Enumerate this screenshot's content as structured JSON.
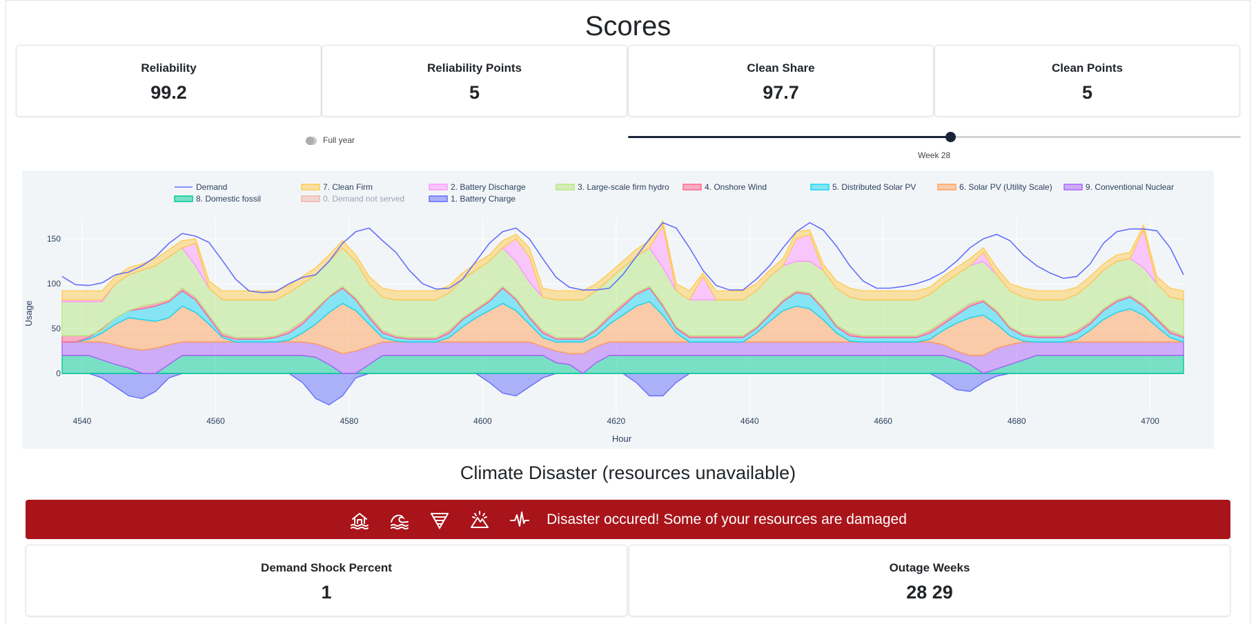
{
  "header": {
    "title": "Scores"
  },
  "scores": [
    {
      "label": "Reliability",
      "value": "99.2"
    },
    {
      "label": "Reliability Points",
      "value": "5"
    },
    {
      "label": "Clean Share",
      "value": "97.7"
    },
    {
      "label": "Clean Points",
      "value": "5"
    }
  ],
  "controls": {
    "full_year_label": "Full year",
    "full_year_on": false,
    "week_label": "Week 28",
    "week_value": 28
  },
  "chart_data": {
    "type": "area",
    "xlabel": "Hour",
    "ylabel": "Usage",
    "xlim": [
      4537,
      4705
    ],
    "ylim": [
      -45,
      180
    ],
    "x_ticks": [
      4540,
      4560,
      4580,
      4600,
      4620,
      4640,
      4660,
      4680,
      4700
    ],
    "y_ticks": [
      0,
      50,
      100,
      150
    ],
    "legend": [
      {
        "name": "Demand",
        "color": "#636efa",
        "kind": "line"
      },
      {
        "name": "7. Clean Firm",
        "color": "#fecb52"
      },
      {
        "name": "2. Battery Discharge",
        "color": "#ff97ff"
      },
      {
        "name": "3. Large-scale firm hydro",
        "color": "#b6e880"
      },
      {
        "name": "4. Onshore Wind",
        "color": "#ff6692"
      },
      {
        "name": "5. Distributed Solar PV",
        "color": "#19d3f3"
      },
      {
        "name": "6. Solar PV (Utility Scale)",
        "color": "#ffa15a"
      },
      {
        "name": "9. Conventional Nuclear",
        "color": "#ab63fa"
      },
      {
        "name": "8. Domestic fossil",
        "color": "#00cc96"
      },
      {
        "name": "0. Demand not served",
        "color": "#ef553b",
        "hidden": true
      },
      {
        "name": "1. Battery Charge",
        "color": "#636efa"
      }
    ],
    "series": {
      "demand_x": [
        4537,
        4539,
        4541,
        4543,
        4545,
        4547,
        4549,
        4551,
        4553,
        4555,
        4557,
        4559,
        4561,
        4563,
        4565,
        4567,
        4569,
        4571,
        4573,
        4575,
        4577,
        4579,
        4581,
        4583,
        4585,
        4587,
        4589,
        4591,
        4593,
        4595,
        4597,
        4599,
        4601,
        4603,
        4605,
        4607,
        4609,
        4611,
        4613,
        4615,
        4617,
        4619,
        4621,
        4623,
        4625,
        4627,
        4629,
        4631,
        4633,
        4635,
        4637,
        4639,
        4641,
        4643,
        4645,
        4647,
        4649,
        4651,
        4653,
        4655,
        4657,
        4659,
        4661,
        4663,
        4665,
        4667,
        4669,
        4671,
        4673,
        4675,
        4677,
        4679,
        4681,
        4683,
        4685,
        4687,
        4689,
        4691,
        4693,
        4695,
        4697,
        4699,
        4701,
        4703,
        4705
      ],
      "demand_y": [
        108,
        99,
        98,
        101,
        110,
        113,
        120,
        130,
        145,
        156,
        153,
        146,
        126,
        105,
        92,
        90,
        91,
        100,
        107,
        110,
        125,
        145,
        158,
        162,
        148,
        135,
        115,
        100,
        94,
        95,
        105,
        125,
        145,
        158,
        162,
        150,
        128,
        107,
        96,
        93,
        93,
        95,
        110,
        130,
        150,
        168,
        162,
        140,
        115,
        98,
        93,
        93,
        105,
        120,
        140,
        158,
        168,
        160,
        142,
        120,
        103,
        95,
        95,
        97,
        100,
        105,
        113,
        125,
        140,
        150,
        155,
        148,
        132,
        120,
        112,
        106,
        108,
        122,
        145,
        158,
        161,
        161,
        159,
        140,
        110
      ],
      "fossil": [
        20,
        20,
        20,
        15,
        10,
        6,
        0,
        0,
        10,
        20,
        20,
        20,
        20,
        20,
        20,
        20,
        20,
        20,
        20,
        18,
        10,
        0,
        0,
        10,
        20,
        20,
        20,
        20,
        20,
        20,
        20,
        20,
        20,
        20,
        20,
        20,
        20,
        12,
        10,
        0,
        12,
        20,
        20,
        20,
        20,
        20,
        20,
        20,
        20,
        20,
        20,
        20,
        20,
        20,
        20,
        20,
        20,
        20,
        20,
        20,
        20,
        20,
        20,
        20,
        20,
        20,
        20,
        16,
        10,
        0,
        5,
        10,
        15,
        20,
        20,
        20,
        20,
        20,
        20,
        20,
        20,
        20,
        20,
        20,
        20
      ],
      "nuclear_top": [
        35,
        35,
        35,
        35,
        32,
        28,
        26,
        28,
        32,
        35,
        35,
        35,
        35,
        35,
        35,
        35,
        35,
        35,
        35,
        33,
        28,
        22,
        25,
        30,
        35,
        35,
        35,
        35,
        35,
        35,
        35,
        35,
        35,
        35,
        35,
        35,
        30,
        25,
        22,
        22,
        30,
        35,
        35,
        35,
        35,
        35,
        35,
        35,
        35,
        35,
        35,
        35,
        35,
        35,
        35,
        35,
        35,
        35,
        35,
        35,
        35,
        35,
        35,
        35,
        35,
        35,
        32,
        25,
        20,
        20,
        28,
        32,
        35,
        35,
        35,
        35,
        35,
        35,
        35,
        35,
        35,
        35,
        35,
        35,
        35
      ],
      "utility_top": [
        35,
        35,
        38,
        45,
        55,
        62,
        60,
        58,
        62,
        75,
        68,
        55,
        40,
        35,
        35,
        35,
        35,
        37,
        45,
        55,
        68,
        78,
        70,
        55,
        40,
        36,
        35,
        35,
        35,
        40,
        52,
        62,
        70,
        78,
        70,
        55,
        40,
        35,
        35,
        35,
        42,
        55,
        65,
        75,
        80,
        65,
        45,
        35,
        35,
        35,
        35,
        35,
        45,
        58,
        70,
        75,
        72,
        60,
        45,
        36,
        35,
        35,
        35,
        35,
        35,
        38,
        48,
        56,
        62,
        65,
        55,
        42,
        36,
        35,
        35,
        35,
        38,
        48,
        60,
        68,
        72,
        65,
        52,
        40,
        35
      ],
      "distsolar_top": [
        35,
        35,
        40,
        50,
        62,
        70,
        72,
        75,
        80,
        92,
        82,
        62,
        42,
        38,
        38,
        38,
        40,
        45,
        55,
        70,
        85,
        95,
        82,
        62,
        45,
        40,
        38,
        38,
        38,
        45,
        60,
        70,
        80,
        95,
        82,
        62,
        45,
        38,
        38,
        38,
        48,
        62,
        75,
        88,
        95,
        75,
        50,
        40,
        40,
        40,
        40,
        40,
        50,
        65,
        80,
        90,
        88,
        72,
        52,
        42,
        40,
        40,
        40,
        40,
        40,
        45,
        55,
        65,
        75,
        80,
        68,
        50,
        42,
        40,
        40,
        40,
        45,
        55,
        70,
        80,
        85,
        75,
        60,
        45,
        40
      ],
      "wind_top": [
        42,
        42,
        42,
        48,
        62,
        70,
        75,
        78,
        82,
        95,
        85,
        65,
        45,
        40,
        40,
        40,
        42,
        48,
        58,
        72,
        86,
        97,
        84,
        65,
        48,
        42,
        40,
        40,
        40,
        48,
        62,
        72,
        82,
        97,
        84,
        64,
        48,
        40,
        40,
        40,
        50,
        65,
        78,
        90,
        97,
        77,
        52,
        42,
        42,
        42,
        42,
        42,
        52,
        67,
        82,
        92,
        90,
        74,
        54,
        45,
        42,
        42,
        42,
        42,
        42,
        48,
        58,
        68,
        78,
        82,
        70,
        52,
        44,
        42,
        42,
        42,
        48,
        58,
        72,
        82,
        87,
        77,
        62,
        48,
        42
      ],
      "hydro_top": [
        80,
        80,
        80,
        80,
        100,
        110,
        115,
        120,
        130,
        140,
        120,
        95,
        82,
        82,
        82,
        82,
        82,
        90,
        100,
        110,
        125,
        140,
        125,
        100,
        85,
        82,
        82,
        82,
        82,
        90,
        105,
        115,
        125,
        140,
        125,
        102,
        85,
        82,
        82,
        82,
        92,
        105,
        118,
        130,
        140,
        118,
        92,
        82,
        82,
        82,
        82,
        82,
        92,
        108,
        120,
        125,
        125,
        115,
        95,
        85,
        82,
        82,
        82,
        82,
        82,
        88,
        100,
        110,
        120,
        125,
        110,
        92,
        85,
        82,
        82,
        82,
        88,
        100,
        115,
        125,
        128,
        118,
        100,
        85,
        82
      ],
      "discharge_top": [
        82,
        82,
        82,
        82,
        100,
        110,
        115,
        120,
        130,
        140,
        145,
        95,
        82,
        82,
        82,
        82,
        82,
        90,
        100,
        110,
        125,
        140,
        125,
        100,
        85,
        82,
        82,
        82,
        82,
        90,
        105,
        115,
        125,
        140,
        150,
        130,
        85,
        82,
        82,
        82,
        92,
        105,
        118,
        130,
        140,
        165,
        92,
        82,
        108,
        82,
        82,
        82,
        92,
        108,
        120,
        150,
        155,
        115,
        95,
        85,
        82,
        82,
        82,
        82,
        82,
        88,
        100,
        110,
        120,
        135,
        110,
        92,
        85,
        82,
        82,
        82,
        88,
        100,
        115,
        125,
        128,
        160,
        100,
        85,
        82
      ],
      "cleanfirm_top": [
        92,
        92,
        92,
        92,
        108,
        118,
        122,
        128,
        138,
        148,
        150,
        103,
        92,
        92,
        92,
        92,
        92,
        98,
        108,
        118,
        132,
        148,
        132,
        108,
        95,
        92,
        92,
        92,
        92,
        98,
        112,
        123,
        132,
        148,
        155,
        140,
        95,
        92,
        92,
        92,
        100,
        112,
        125,
        138,
        148,
        170,
        100,
        92,
        112,
        92,
        92,
        92,
        100,
        115,
        128,
        158,
        160,
        122,
        103,
        95,
        92,
        92,
        92,
        92,
        92,
        96,
        108,
        118,
        128,
        140,
        118,
        100,
        95,
        92,
        92,
        92,
        96,
        108,
        122,
        132,
        135,
        165,
        108,
        95,
        92
      ],
      "charge_bottom": [
        0,
        0,
        0,
        -5,
        -15,
        -25,
        -28,
        -20,
        -5,
        0,
        0,
        0,
        0,
        0,
        0,
        0,
        0,
        0,
        -10,
        -28,
        -35,
        -25,
        -5,
        0,
        0,
        0,
        0,
        0,
        0,
        0,
        0,
        0,
        -10,
        -22,
        -25,
        -15,
        -5,
        0,
        0,
        0,
        0,
        0,
        0,
        -10,
        -25,
        -25,
        -10,
        0,
        0,
        0,
        0,
        0,
        0,
        0,
        0,
        0,
        0,
        0,
        0,
        0,
        0,
        0,
        0,
        0,
        0,
        0,
        -8,
        -18,
        -20,
        -10,
        -3,
        0,
        0,
        0,
        0,
        0,
        0,
        0,
        0,
        0,
        0,
        0,
        0,
        0,
        0
      ]
    }
  },
  "climate": {
    "title": "Climate Disaster (resources unavailable)",
    "alert_message": "Disaster occured! Some of your resources are damaged",
    "icons": [
      "flood-house-icon",
      "wave-icon",
      "tornado-icon",
      "wildfire-icon",
      "earthquake-icon"
    ],
    "cards": [
      {
        "label": "Demand Shock Percent",
        "value": "1"
      },
      {
        "label": "Outage Weeks",
        "value": "28 29"
      }
    ]
  }
}
